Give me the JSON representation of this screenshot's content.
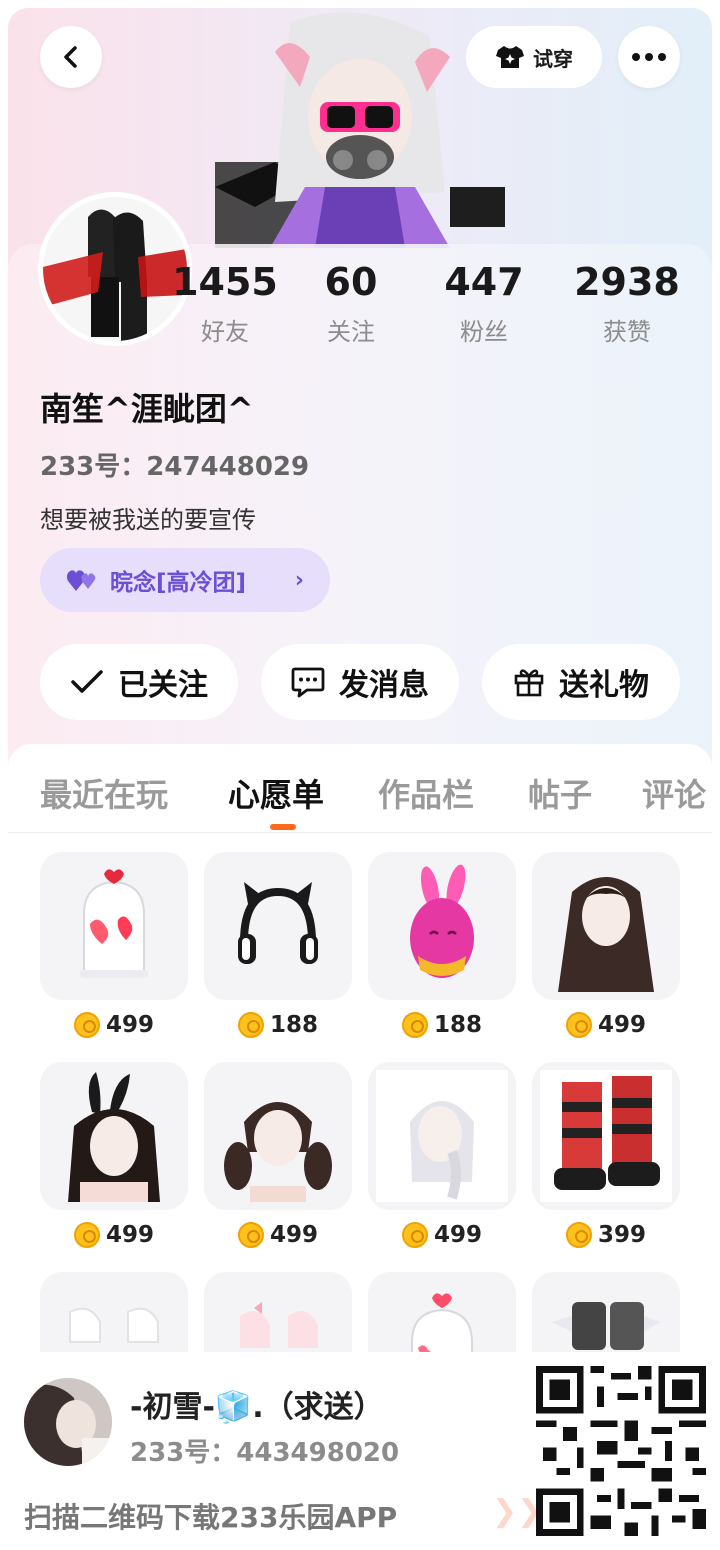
{
  "header": {
    "tryon_label": "试穿"
  },
  "stats": [
    {
      "value": "1455",
      "label": "好友"
    },
    {
      "value": "60",
      "label": "关注"
    },
    {
      "value": "447",
      "label": "粉丝"
    },
    {
      "value": "2938",
      "label": "获赞"
    }
  ],
  "profile": {
    "nickname": "南笙^涯眦团^",
    "uid": "233号：247448029",
    "bio": "想要被我送的要宣传",
    "group": "晥念[高冷团]"
  },
  "actions": {
    "follow": "已关注",
    "message": "发消息",
    "gift": "送礼物"
  },
  "tabs": [
    {
      "label": "最近在玩"
    },
    {
      "label": "心愿单"
    },
    {
      "label": "作品栏"
    },
    {
      "label": "帖子"
    },
    {
      "label": "评论"
    }
  ],
  "active_tab": "心愿单",
  "wishlist": [
    {
      "name": "heart-jar",
      "price": "499"
    },
    {
      "name": "cat-ear-headphones",
      "price": "188"
    },
    {
      "name": "pink-bunny-egg",
      "price": "188"
    },
    {
      "name": "long-dark-hair",
      "price": "499"
    },
    {
      "name": "bunny-ears-hair",
      "price": "499"
    },
    {
      "name": "twin-tail-hair",
      "price": "499"
    },
    {
      "name": "silver-braid-hair",
      "price": "499"
    },
    {
      "name": "striped-boots",
      "price": "399"
    },
    {
      "name": "white-socks",
      "price": ""
    },
    {
      "name": "pink-bow-shoes",
      "price": ""
    },
    {
      "name": "heart-jar-2",
      "price": ""
    },
    {
      "name": "winged-boots",
      "price": ""
    }
  ],
  "share": {
    "name": "-初雪-🧊.（求送）",
    "uid": "233号：443498020",
    "cta": "扫描二维码下载233乐园APP",
    "arrows": "❯❯"
  },
  "colors": {
    "accent": "#ff6a1a",
    "group_chip_bg": "#e6defa",
    "group_chip_text": "#6d4fd6",
    "coin": "#ffc21c"
  }
}
